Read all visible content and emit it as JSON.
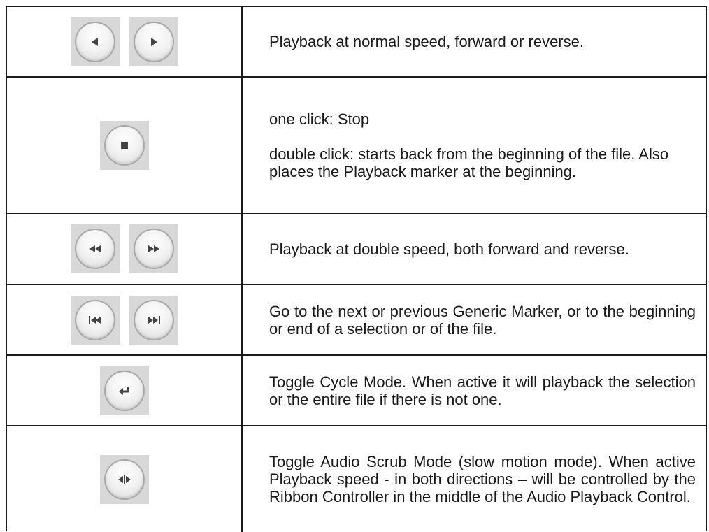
{
  "rows": [
    {
      "icons": [
        "play-reverse-icon",
        "play-forward-icon"
      ],
      "text": [
        "Playback at normal speed, forward or reverse."
      ]
    },
    {
      "icons": [
        "stop-icon"
      ],
      "text": [
        "one click: Stop",
        "double click: starts back from the beginning of the file. Also places the Playback marker at the beginning."
      ]
    },
    {
      "icons": [
        "fast-reverse-icon",
        "fast-forward-icon"
      ],
      "text": [
        "Playback at double speed, both forward and reverse."
      ]
    },
    {
      "icons": [
        "skip-to-previous-icon",
        "skip-to-next-icon"
      ],
      "text": [
        "Go to the next or previous Generic Marker, or to the beginning or end of a selection or of the file."
      ]
    },
    {
      "icons": [
        "cycle-mode-icon"
      ],
      "text": [
        "Toggle Cycle Mode. When active it will playback the selection or the entire file if there is not one."
      ]
    },
    {
      "icons": [
        "audio-scrub-icon"
      ],
      "text": [
        "Toggle Audio Scrub Mode (slow motion mode). When active Playback speed - in both directions – will be controlled by the Ribbon Controller in the middle of the Audio Playback Control."
      ]
    }
  ],
  "colors": {
    "border": "#1a1a1a",
    "button_bg": "#d8d8d8",
    "glyph": "#444444"
  }
}
